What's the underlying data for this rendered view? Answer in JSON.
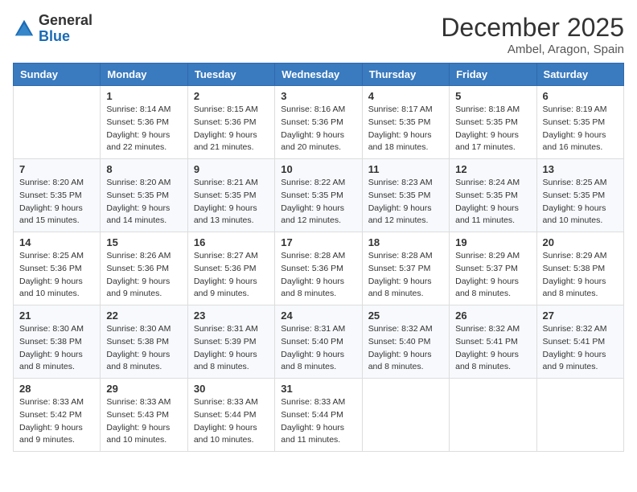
{
  "header": {
    "logo_general": "General",
    "logo_blue": "Blue",
    "month": "December 2025",
    "location": "Ambel, Aragon, Spain"
  },
  "weekdays": [
    "Sunday",
    "Monday",
    "Tuesday",
    "Wednesday",
    "Thursday",
    "Friday",
    "Saturday"
  ],
  "weeks": [
    [
      {
        "day": "",
        "sunrise": "",
        "sunset": "",
        "daylight": ""
      },
      {
        "day": "1",
        "sunrise": "Sunrise: 8:14 AM",
        "sunset": "Sunset: 5:36 PM",
        "daylight": "Daylight: 9 hours and 22 minutes."
      },
      {
        "day": "2",
        "sunrise": "Sunrise: 8:15 AM",
        "sunset": "Sunset: 5:36 PM",
        "daylight": "Daylight: 9 hours and 21 minutes."
      },
      {
        "day": "3",
        "sunrise": "Sunrise: 8:16 AM",
        "sunset": "Sunset: 5:36 PM",
        "daylight": "Daylight: 9 hours and 20 minutes."
      },
      {
        "day": "4",
        "sunrise": "Sunrise: 8:17 AM",
        "sunset": "Sunset: 5:35 PM",
        "daylight": "Daylight: 9 hours and 18 minutes."
      },
      {
        "day": "5",
        "sunrise": "Sunrise: 8:18 AM",
        "sunset": "Sunset: 5:35 PM",
        "daylight": "Daylight: 9 hours and 17 minutes."
      },
      {
        "day": "6",
        "sunrise": "Sunrise: 8:19 AM",
        "sunset": "Sunset: 5:35 PM",
        "daylight": "Daylight: 9 hours and 16 minutes."
      }
    ],
    [
      {
        "day": "7",
        "sunrise": "Sunrise: 8:20 AM",
        "sunset": "Sunset: 5:35 PM",
        "daylight": "Daylight: 9 hours and 15 minutes."
      },
      {
        "day": "8",
        "sunrise": "Sunrise: 8:20 AM",
        "sunset": "Sunset: 5:35 PM",
        "daylight": "Daylight: 9 hours and 14 minutes."
      },
      {
        "day": "9",
        "sunrise": "Sunrise: 8:21 AM",
        "sunset": "Sunset: 5:35 PM",
        "daylight": "Daylight: 9 hours and 13 minutes."
      },
      {
        "day": "10",
        "sunrise": "Sunrise: 8:22 AM",
        "sunset": "Sunset: 5:35 PM",
        "daylight": "Daylight: 9 hours and 12 minutes."
      },
      {
        "day": "11",
        "sunrise": "Sunrise: 8:23 AM",
        "sunset": "Sunset: 5:35 PM",
        "daylight": "Daylight: 9 hours and 12 minutes."
      },
      {
        "day": "12",
        "sunrise": "Sunrise: 8:24 AM",
        "sunset": "Sunset: 5:35 PM",
        "daylight": "Daylight: 9 hours and 11 minutes."
      },
      {
        "day": "13",
        "sunrise": "Sunrise: 8:25 AM",
        "sunset": "Sunset: 5:35 PM",
        "daylight": "Daylight: 9 hours and 10 minutes."
      }
    ],
    [
      {
        "day": "14",
        "sunrise": "Sunrise: 8:25 AM",
        "sunset": "Sunset: 5:36 PM",
        "daylight": "Daylight: 9 hours and 10 minutes."
      },
      {
        "day": "15",
        "sunrise": "Sunrise: 8:26 AM",
        "sunset": "Sunset: 5:36 PM",
        "daylight": "Daylight: 9 hours and 9 minutes."
      },
      {
        "day": "16",
        "sunrise": "Sunrise: 8:27 AM",
        "sunset": "Sunset: 5:36 PM",
        "daylight": "Daylight: 9 hours and 9 minutes."
      },
      {
        "day": "17",
        "sunrise": "Sunrise: 8:28 AM",
        "sunset": "Sunset: 5:36 PM",
        "daylight": "Daylight: 9 hours and 8 minutes."
      },
      {
        "day": "18",
        "sunrise": "Sunrise: 8:28 AM",
        "sunset": "Sunset: 5:37 PM",
        "daylight": "Daylight: 9 hours and 8 minutes."
      },
      {
        "day": "19",
        "sunrise": "Sunrise: 8:29 AM",
        "sunset": "Sunset: 5:37 PM",
        "daylight": "Daylight: 9 hours and 8 minutes."
      },
      {
        "day": "20",
        "sunrise": "Sunrise: 8:29 AM",
        "sunset": "Sunset: 5:38 PM",
        "daylight": "Daylight: 9 hours and 8 minutes."
      }
    ],
    [
      {
        "day": "21",
        "sunrise": "Sunrise: 8:30 AM",
        "sunset": "Sunset: 5:38 PM",
        "daylight": "Daylight: 9 hours and 8 minutes."
      },
      {
        "day": "22",
        "sunrise": "Sunrise: 8:30 AM",
        "sunset": "Sunset: 5:38 PM",
        "daylight": "Daylight: 9 hours and 8 minutes."
      },
      {
        "day": "23",
        "sunrise": "Sunrise: 8:31 AM",
        "sunset": "Sunset: 5:39 PM",
        "daylight": "Daylight: 9 hours and 8 minutes."
      },
      {
        "day": "24",
        "sunrise": "Sunrise: 8:31 AM",
        "sunset": "Sunset: 5:40 PM",
        "daylight": "Daylight: 9 hours and 8 minutes."
      },
      {
        "day": "25",
        "sunrise": "Sunrise: 8:32 AM",
        "sunset": "Sunset: 5:40 PM",
        "daylight": "Daylight: 9 hours and 8 minutes."
      },
      {
        "day": "26",
        "sunrise": "Sunrise: 8:32 AM",
        "sunset": "Sunset: 5:41 PM",
        "daylight": "Daylight: 9 hours and 8 minutes."
      },
      {
        "day": "27",
        "sunrise": "Sunrise: 8:32 AM",
        "sunset": "Sunset: 5:41 PM",
        "daylight": "Daylight: 9 hours and 9 minutes."
      }
    ],
    [
      {
        "day": "28",
        "sunrise": "Sunrise: 8:33 AM",
        "sunset": "Sunset: 5:42 PM",
        "daylight": "Daylight: 9 hours and 9 minutes."
      },
      {
        "day": "29",
        "sunrise": "Sunrise: 8:33 AM",
        "sunset": "Sunset: 5:43 PM",
        "daylight": "Daylight: 9 hours and 10 minutes."
      },
      {
        "day": "30",
        "sunrise": "Sunrise: 8:33 AM",
        "sunset": "Sunset: 5:44 PM",
        "daylight": "Daylight: 9 hours and 10 minutes."
      },
      {
        "day": "31",
        "sunrise": "Sunrise: 8:33 AM",
        "sunset": "Sunset: 5:44 PM",
        "daylight": "Daylight: 9 hours and 11 minutes."
      },
      {
        "day": "",
        "sunrise": "",
        "sunset": "",
        "daylight": ""
      },
      {
        "day": "",
        "sunrise": "",
        "sunset": "",
        "daylight": ""
      },
      {
        "day": "",
        "sunrise": "",
        "sunset": "",
        "daylight": ""
      }
    ]
  ]
}
